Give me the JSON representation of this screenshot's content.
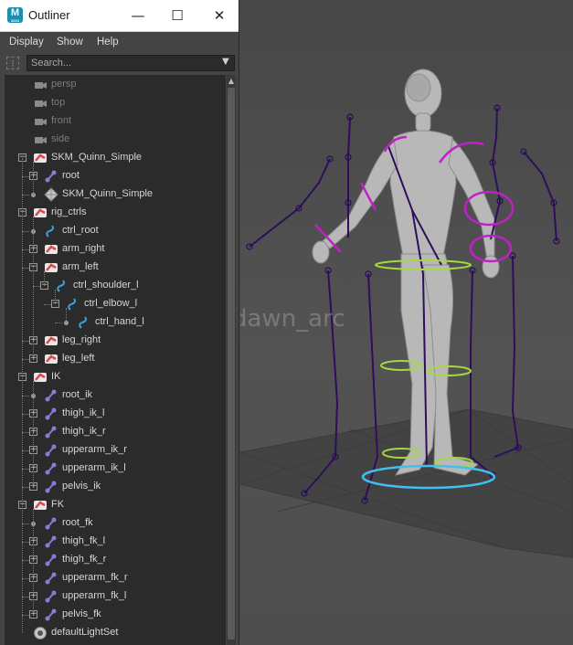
{
  "window": {
    "title": "Outliner",
    "app_icon_text": "M",
    "app_icon_sub": "2024",
    "minimize": "—",
    "maximize": "☐",
    "close": "✕"
  },
  "menu": [
    "Display",
    "Show",
    "Help"
  ],
  "search": {
    "placeholder": "Search..."
  },
  "tree": [
    {
      "label": "persp",
      "icon": "camera-icon",
      "depth": 1,
      "expander": "none",
      "dim": true
    },
    {
      "label": "top",
      "icon": "camera-icon",
      "depth": 1,
      "expander": "none",
      "dim": true
    },
    {
      "label": "front",
      "icon": "camera-icon",
      "depth": 1,
      "expander": "none",
      "dim": true
    },
    {
      "label": "side",
      "icon": "camera-icon",
      "depth": 1,
      "expander": "none",
      "dim": true
    },
    {
      "label": "SKM_Quinn_Simple",
      "icon": "transform-group-icon",
      "depth": 1,
      "expander": "minus"
    },
    {
      "label": "root",
      "icon": "joint-icon",
      "depth": 2,
      "expander": "plus"
    },
    {
      "label": "SKM_Quinn_Simple",
      "icon": "mesh-icon",
      "depth": 2,
      "expander": "dot"
    },
    {
      "label": "rig_ctrls",
      "icon": "transform-group-icon",
      "depth": 1,
      "expander": "minus"
    },
    {
      "label": "ctrl_root",
      "icon": "curve-icon",
      "depth": 2,
      "expander": "dot"
    },
    {
      "label": "arm_right",
      "icon": "transform-group-icon",
      "depth": 2,
      "expander": "plus"
    },
    {
      "label": "arm_left",
      "icon": "transform-group-icon",
      "depth": 2,
      "expander": "minus"
    },
    {
      "label": "ctrl_shoulder_l",
      "icon": "curve-icon",
      "depth": 3,
      "expander": "minus"
    },
    {
      "label": "ctrl_elbow_l",
      "icon": "curve-icon",
      "depth": 4,
      "expander": "minus"
    },
    {
      "label": "ctrl_hand_l",
      "icon": "curve-icon",
      "depth": 5,
      "expander": "dot"
    },
    {
      "label": "leg_right",
      "icon": "transform-group-icon",
      "depth": 2,
      "expander": "plus"
    },
    {
      "label": "leg_left",
      "icon": "transform-group-icon",
      "depth": 2,
      "expander": "plus"
    },
    {
      "label": "IK",
      "icon": "transform-group-icon",
      "depth": 1,
      "expander": "minus"
    },
    {
      "label": "root_ik",
      "icon": "joint-icon",
      "depth": 2,
      "expander": "dot"
    },
    {
      "label": "thigh_ik_l",
      "icon": "joint-icon",
      "depth": 2,
      "expander": "plus"
    },
    {
      "label": "thigh_ik_r",
      "icon": "joint-icon",
      "depth": 2,
      "expander": "plus"
    },
    {
      "label": "upperarm_ik_r",
      "icon": "joint-icon",
      "depth": 2,
      "expander": "plus"
    },
    {
      "label": "upperarm_ik_l",
      "icon": "joint-icon",
      "depth": 2,
      "expander": "plus"
    },
    {
      "label": "pelvis_ik",
      "icon": "joint-icon",
      "depth": 2,
      "expander": "plus"
    },
    {
      "label": "FK",
      "icon": "transform-group-icon",
      "depth": 1,
      "expander": "minus"
    },
    {
      "label": "root_fk",
      "icon": "joint-icon",
      "depth": 2,
      "expander": "dot"
    },
    {
      "label": "thigh_fk_l",
      "icon": "joint-icon",
      "depth": 2,
      "expander": "plus"
    },
    {
      "label": "thigh_fk_r",
      "icon": "joint-icon",
      "depth": 2,
      "expander": "plus"
    },
    {
      "label": "upperarm_fk_r",
      "icon": "joint-icon",
      "depth": 2,
      "expander": "plus"
    },
    {
      "label": "upperarm_fk_l",
      "icon": "joint-icon",
      "depth": 2,
      "expander": "plus"
    },
    {
      "label": "pelvis_fk",
      "icon": "joint-icon",
      "depth": 2,
      "expander": "plus"
    },
    {
      "label": "defaultLightSet",
      "icon": "set-icon",
      "depth": 1,
      "expander": "none"
    }
  ],
  "watermark": "@dawn_arc",
  "colors": {
    "joint": "#8c7bd6",
    "curve": "#3aa0e0",
    "group_red": "#e04848",
    "control_magenta": "#c020c8",
    "control_lime": "#a8d840",
    "control_cyan": "#40c0f0",
    "bone_purple": "#3a1a6a"
  }
}
